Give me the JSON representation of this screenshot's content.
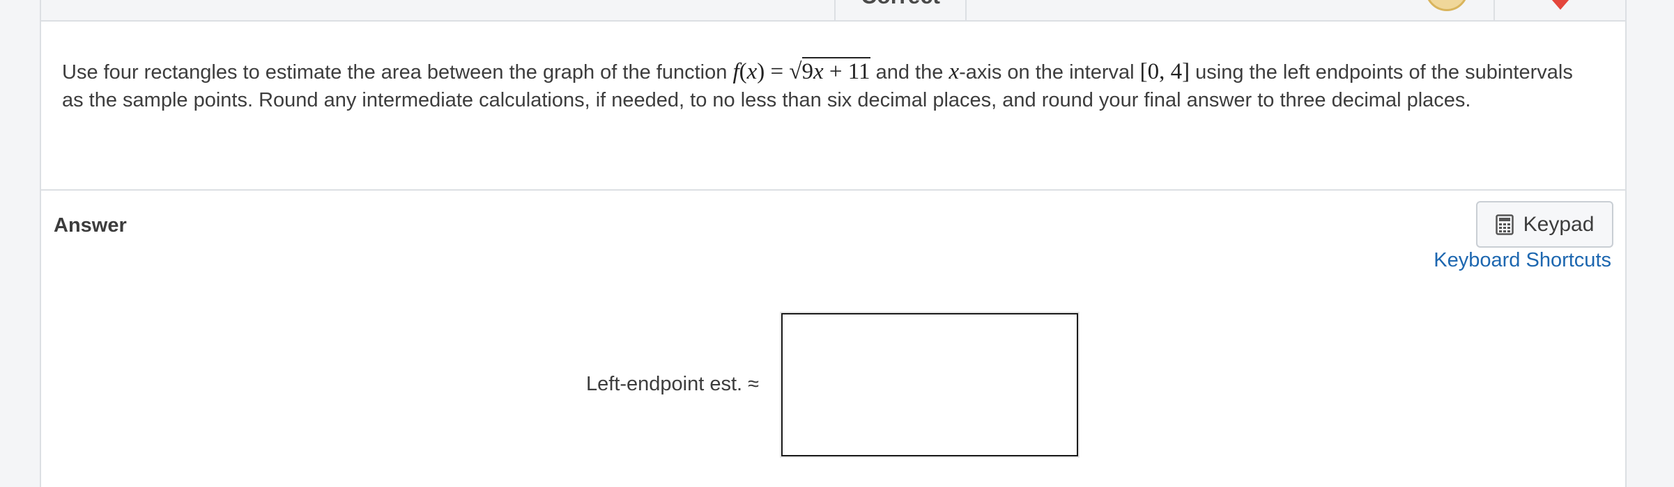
{
  "header": {
    "status_label": "Correct",
    "icons": [
      "coin-icon",
      "heart-icon"
    ],
    "colors": {
      "coin": "#f0d79a",
      "heart": "#e4463c"
    }
  },
  "question": {
    "part1": "Use four rectangles to estimate the area between the graph of the function ",
    "fn_name": "f",
    "fn_open": "(",
    "fn_var": "x",
    "fn_close": ")",
    "equals": " = ",
    "sqrt_sign": "√",
    "radicand_coef": "9",
    "radicand_var": "x",
    "radicand_rest": " + 11",
    "part2": " and the ",
    "axis_var": "x",
    "part3": "-axis on the interval ",
    "interval": "[0, 4]",
    "part4": " using the left endpoints of the subintervals as the sample points. Round any intermediate calculations, if needed, to no less than six decimal places, and round your final answer to three decimal places."
  },
  "answer": {
    "section_label": "Answer",
    "keypad_label": "Keypad",
    "keypad_icon": "calculator-icon",
    "shortcuts_label": "Keyboard Shortcuts",
    "estimate_label": "Left-endpoint est. ≈",
    "input_value": "",
    "input_placeholder": ""
  },
  "colors": {
    "link": "#1d67b0",
    "text": "#3d3d3d",
    "border": "#dcdfe3",
    "background": "#f4f5f7"
  }
}
